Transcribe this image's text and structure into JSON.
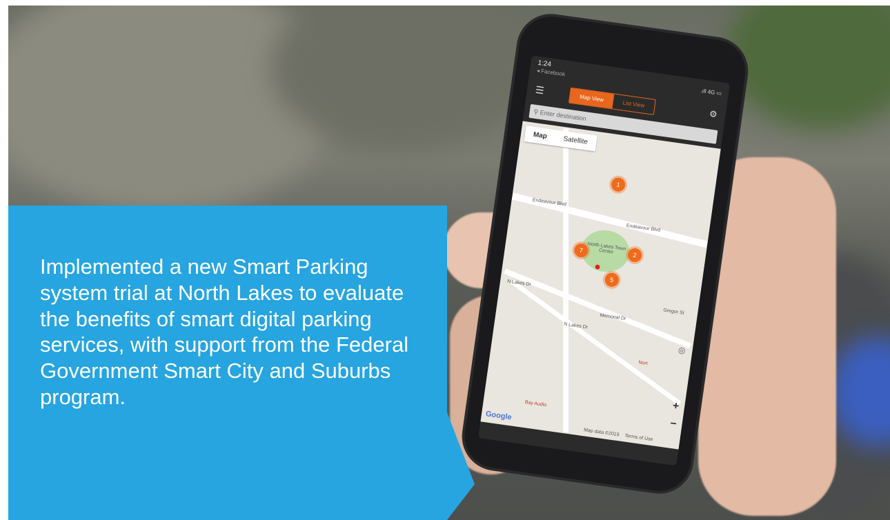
{
  "caption": {
    "text": "Implemented a new Smart Parking system trial at North Lakes to evaluate the benefits of smart digital parking services, with support from the Federal Government Smart City and Suburbs program."
  },
  "phone": {
    "status_time": "1:24",
    "status_back": "◂ Facebook",
    "status_signal": ".ıll 4G ▭",
    "tabs": [
      "Map View",
      "List View"
    ],
    "search_placeholder": "Enter destination",
    "map_tabs": [
      "Map",
      "Satellite"
    ],
    "map_labels": [
      "Endeavour Blvd",
      "Endeavour Blvd",
      "North Lakes Town Centre",
      "N Lakes Dr",
      "N Lakes Dr",
      "Memorial Dr",
      "Gregor St",
      "Nort",
      "Bay Audio",
      "Map data ©2019",
      "Terms of Use"
    ],
    "parking_pins": [
      "1",
      "7",
      "2",
      "5"
    ],
    "google": "Google"
  },
  "colors": {
    "accent": "#26a5e0",
    "pin": "#ef6a1b"
  }
}
